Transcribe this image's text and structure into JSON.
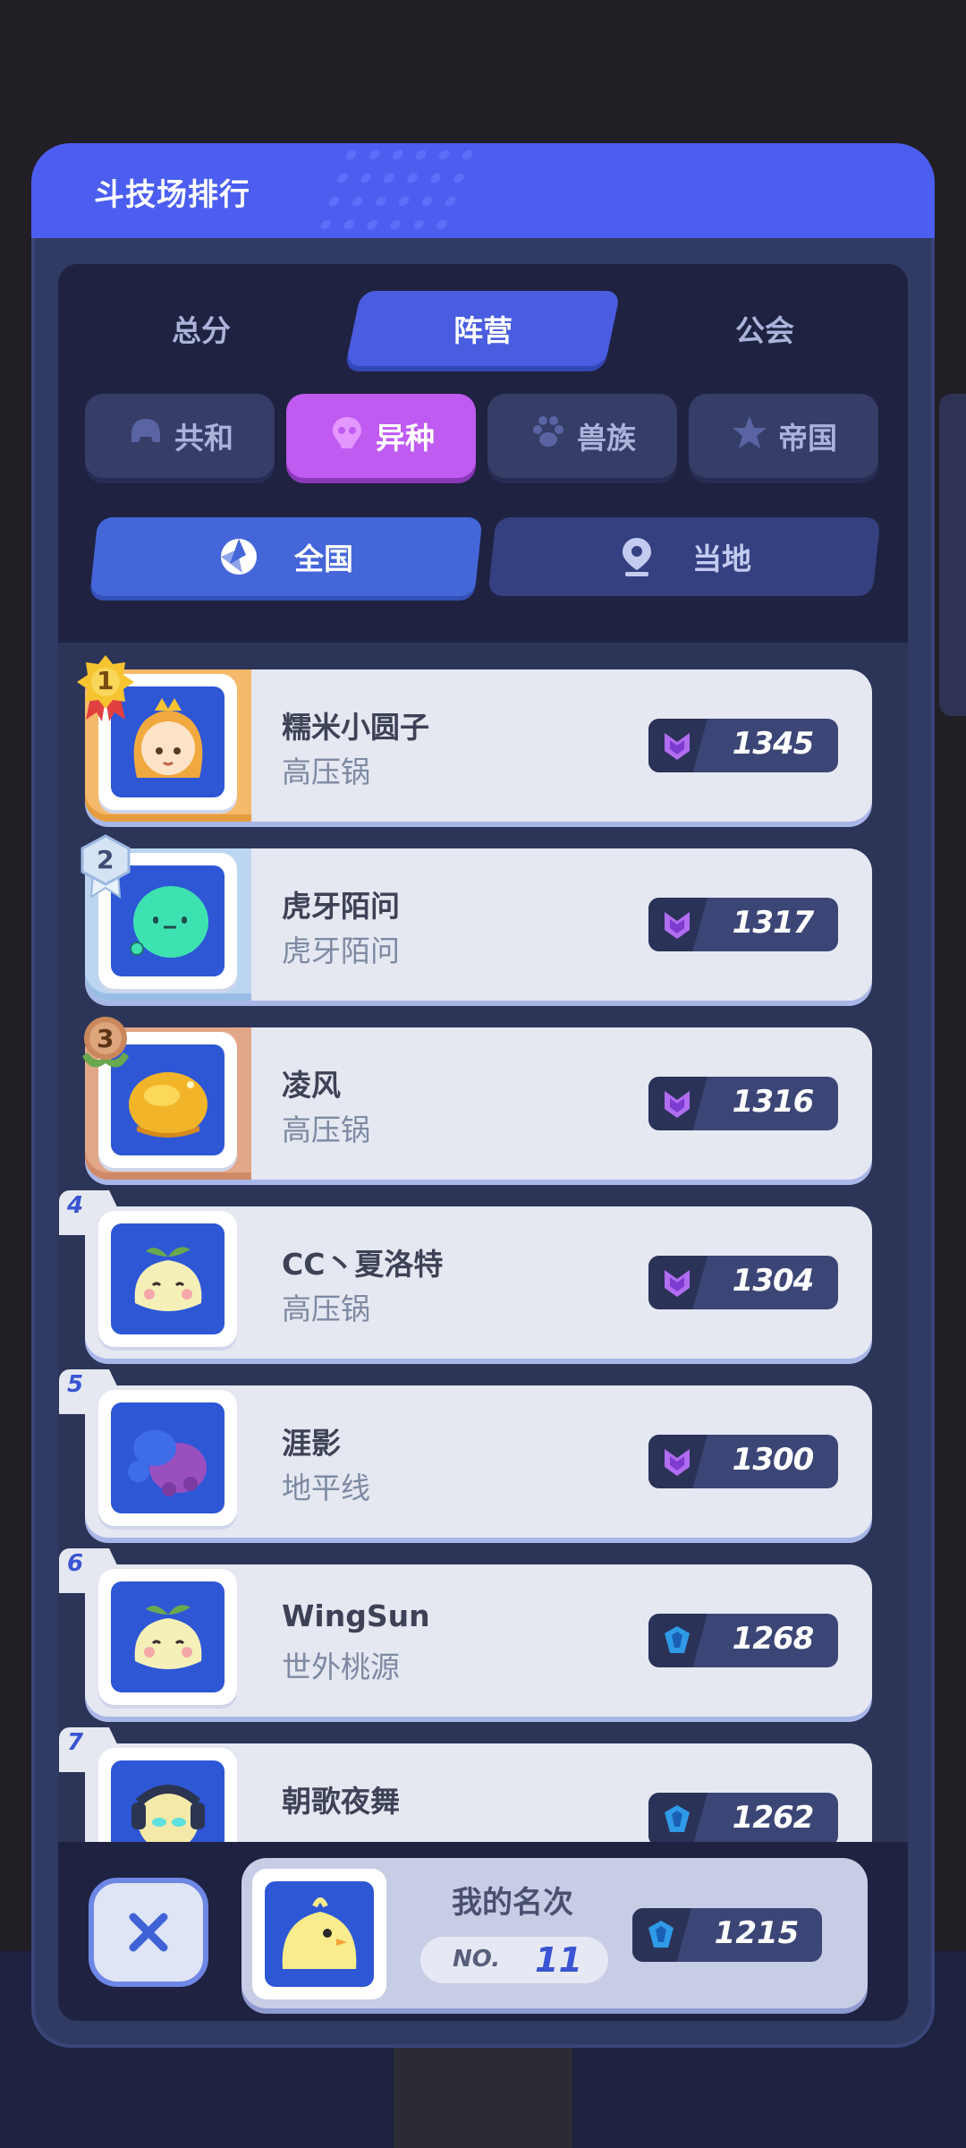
{
  "panel": {
    "title": "斗技场排行"
  },
  "tabs": [
    {
      "label": "总分",
      "active": false
    },
    {
      "label": "阵营",
      "active": true
    },
    {
      "label": "公会",
      "active": false
    }
  ],
  "factions": [
    {
      "label": "共和",
      "icon": "helmet-icon",
      "active": false
    },
    {
      "label": "异种",
      "icon": "alien-icon",
      "active": true
    },
    {
      "label": "兽族",
      "icon": "paw-icon",
      "active": false
    },
    {
      "label": "帝国",
      "icon": "star-emblem-icon",
      "active": false
    }
  ],
  "regions": [
    {
      "label": "全国",
      "icon": "globe-icon",
      "active": true
    },
    {
      "label": "当地",
      "icon": "location-pin-icon",
      "active": false
    }
  ],
  "ranking": [
    {
      "rank": "1",
      "name": "糯米小圆子",
      "guild": "高压锅",
      "score": "1345",
      "tier": "purple",
      "avatar": "princess-avatar"
    },
    {
      "rank": "2",
      "name": "虎牙陌问",
      "guild": "虎牙陌问",
      "score": "1317",
      "tier": "purple",
      "avatar": "slime-avatar"
    },
    {
      "rank": "3",
      "name": "凌风",
      "guild": "高压锅",
      "score": "1316",
      "tier": "purple",
      "avatar": "golden-blob-avatar"
    },
    {
      "rank": "4",
      "name": "CC丶夏洛特",
      "guild": "高压锅",
      "score": "1304",
      "tier": "purple",
      "avatar": "sprout-avatar"
    },
    {
      "rank": "5",
      "name": "涯影",
      "guild": "地平线",
      "score": "1300",
      "tier": "purple",
      "avatar": "octopus-avatar"
    },
    {
      "rank": "6",
      "name": "WingSun",
      "guild": "世外桃源",
      "score": "1268",
      "tier": "blue",
      "avatar": "sprout-avatar"
    },
    {
      "rank": "7",
      "name": "朝歌夜舞",
      "guild": "",
      "score": "1262",
      "tier": "blue",
      "avatar": "robot-avatar"
    }
  ],
  "me": {
    "label": "我的名次",
    "no_label": "NO.",
    "rank": "11",
    "score": "1215",
    "tier": "blue"
  },
  "colors": {
    "accent": "#4c5ef0",
    "active_faction": "#c05af0",
    "gold": "#f4b96a",
    "silver": "#bcd6f1",
    "bronze": "#e2a789"
  }
}
